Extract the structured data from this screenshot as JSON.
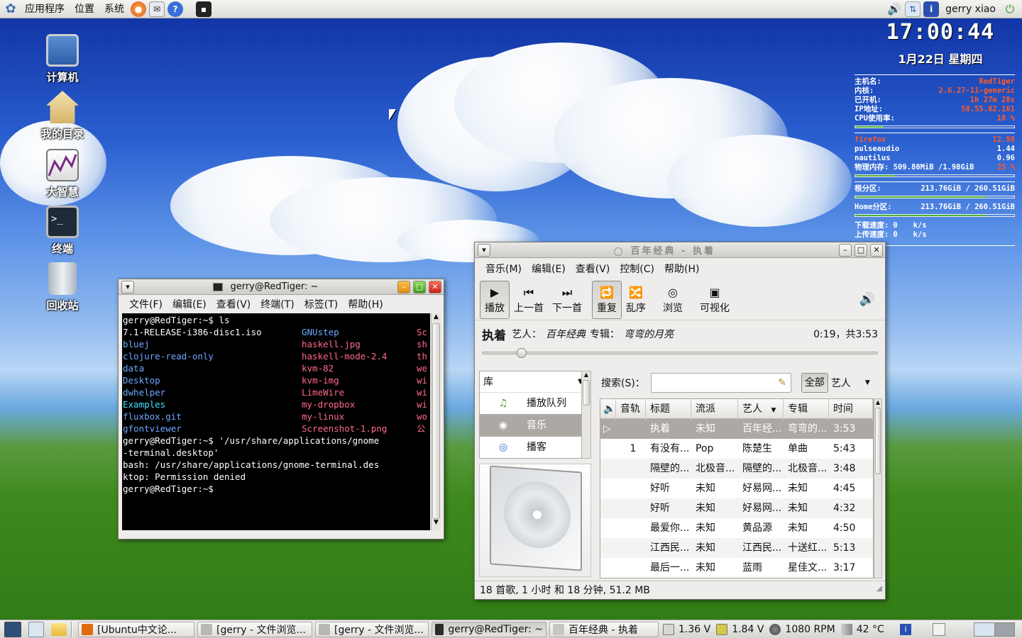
{
  "top_panel": {
    "menus": [
      "应用程序",
      "位置",
      "系统"
    ],
    "user": "gerry  xiao"
  },
  "desktop_icons": [
    {
      "label": "计算机"
    },
    {
      "label": "我的目录"
    },
    {
      "label": "大智慧"
    },
    {
      "label": "终端"
    },
    {
      "label": "回收站"
    }
  ],
  "clock": {
    "time": "17:00:44",
    "date": "1月22日 星期四"
  },
  "conky": {
    "sys": [
      {
        "k": "主机名:",
        "v": "RedTiger"
      },
      {
        "k": "内核:",
        "v": "2.6.27-11-generic"
      },
      {
        "k": "已开机:",
        "v": "1h 27m 28s"
      },
      {
        "k": "IP地址:",
        "v": "58.55.82.161"
      },
      {
        "k": "CPU使用率:",
        "v": "18 %"
      }
    ],
    "cpu_usage_fraction": 0.18,
    "procs": [
      {
        "name": "firefox",
        "val": "12.98"
      },
      {
        "name": "pulseaudio",
        "val": "1.44"
      },
      {
        "name": "nautilus",
        "val": "0.96"
      }
    ],
    "memory": {
      "label": "物理内存:",
      "value": "509.80MiB /1.98GiB",
      "percent": "25 %",
      "fraction": 0.25
    },
    "root_part": {
      "label": "根分区:",
      "value": "213.76GiB / 260.51GiB",
      "fraction": 0.82
    },
    "home_part": {
      "label": "Home分区:",
      "value": "213.76GiB / 260.51GiB",
      "fraction": 0.82
    },
    "down": {
      "label": "下载速度:",
      "value": "0",
      "unit": "k/s"
    },
    "up": {
      "label": "上传速度:",
      "value": "0",
      "unit": "k/s"
    }
  },
  "terminal": {
    "title": "gerry@RedTiger: ~",
    "menus": [
      "文件(F)",
      "编辑(E)",
      "查看(V)",
      "终端(T)",
      "标签(T)",
      "帮助(H)"
    ],
    "prompt1": "gerry@RedTiger:~$ ls",
    "ls_rows": [
      [
        "7.1-RELEASE-i386-disc1.iso",
        "GNUstep",
        "Sc"
      ],
      [
        "bluej",
        "haskell.jpg",
        "sh"
      ],
      [
        "clojure-read-only",
        "haskell-mode-2.4",
        "th"
      ],
      [
        "data",
        "kvm-82",
        "we"
      ],
      [
        "Desktop",
        "kvm-img",
        "wi"
      ],
      [
        "dwhelper",
        "LimeWire",
        "wi"
      ],
      [
        "Examples",
        "my-dropbox",
        "wi"
      ],
      [
        "fluxbox.git",
        "my-linux",
        "wo"
      ],
      [
        "gfontviewer",
        "Screenshot-1.png",
        "公"
      ]
    ],
    "line_cmd1": "gerry@RedTiger:~$ '/usr/share/applications/gnome",
    "line_cmd2": "-terminal.desktop'",
    "line_err1": "bash: /usr/share/applications/gnome-terminal.des",
    "line_err2": "ktop: Permission denied",
    "prompt2": "gerry@RedTiger:~$"
  },
  "player": {
    "title": "百年经典 - 执着",
    "menus": [
      "音乐(M)",
      "编辑(E)",
      "查看(V)",
      "控制(C)",
      "帮助(H)"
    ],
    "toolbar": [
      {
        "label": "播放",
        "icon": "▶"
      },
      {
        "label": "上一首",
        "icon": "⏮"
      },
      {
        "label": "下一首",
        "icon": "⏭"
      },
      {
        "label": "重复",
        "icon": "🔁"
      },
      {
        "label": "乱序",
        "icon": "🔀"
      },
      {
        "label": "浏览",
        "icon": "◎"
      },
      {
        "label": "可视化",
        "icon": "▣"
      }
    ],
    "now_playing": {
      "song": "执着",
      "artist_label": "艺人：",
      "artist": "百年经典",
      "album_label": "专辑：",
      "album": "弯弯的月亮",
      "time": "0:19，共3:53"
    },
    "progress_fraction": 0.09,
    "library": {
      "header": "库",
      "items": [
        "播放队列",
        "音乐",
        "播客"
      ]
    },
    "search_label": "搜索(S)：",
    "search_value": "",
    "filter_all": "全部",
    "filter_field": "艺人",
    "columns": [
      "",
      "音轨",
      "标题",
      "流派",
      "艺人",
      "专辑",
      "时间"
    ],
    "tracks": [
      {
        "play": "▷",
        "track": "",
        "title": "执着",
        "genre": "未知",
        "artist": "百年经...",
        "album": "弯弯的...",
        "time": "3:53"
      },
      {
        "play": "",
        "track": "1",
        "title": "有没有...",
        "genre": "Pop",
        "artist": "陈楚生",
        "album": "单曲",
        "time": "5:43"
      },
      {
        "play": "",
        "track": "",
        "title": "隔壁的...",
        "genre": "北极音...",
        "artist": "隔壁的...",
        "album": "北极音...",
        "time": "3:48"
      },
      {
        "play": "",
        "track": "",
        "title": "好听",
        "genre": "未知",
        "artist": "好易网...",
        "album": "未知",
        "time": "4:45"
      },
      {
        "play": "",
        "track": "",
        "title": "好听",
        "genre": "未知",
        "artist": "好易网...",
        "album": "未知",
        "time": "4:32"
      },
      {
        "play": "",
        "track": "",
        "title": "最爱你...",
        "genre": "未知",
        "artist": "黄品源",
        "album": "未知",
        "time": "4:50"
      },
      {
        "play": "",
        "track": "",
        "title": "江西民...",
        "genre": "未知",
        "artist": "江西民...",
        "album": "十送红...",
        "time": "5:13"
      },
      {
        "play": "",
        "track": "",
        "title": "最后一...",
        "genre": "未知",
        "artist": "蓝雨",
        "album": "星佳文...",
        "time": "3:17"
      }
    ],
    "status": "18 首歌, 1 小时 和 18 分钟, 51.2 MB"
  },
  "taskbar": {
    "tasks": [
      {
        "label": "[Ubuntu中文论...",
        "icon": "firefox-icon",
        "color": "#e06a10"
      },
      {
        "label": "[gerry - 文件浏览...",
        "icon": "folder-icon",
        "color": "#b9b7b2"
      },
      {
        "label": "[gerry - 文件浏览...",
        "icon": "folder-icon",
        "color": "#b9b7b2"
      },
      {
        "label": "gerry@RedTiger: ~",
        "icon": "terminal-icon",
        "color": "#2b2b2b"
      },
      {
        "label": "百年经典 - 执着",
        "icon": "music-icon",
        "color": "#c7c5c0"
      }
    ],
    "sensors": [
      {
        "value": "1.36 V",
        "icon": "voltage-icon"
      },
      {
        "value": "1.84 V",
        "icon": "voltage-icon"
      },
      {
        "value": "1080 RPM",
        "icon": "fan-icon"
      },
      {
        "value": "42 °C",
        "icon": "temperature-icon"
      }
    ]
  }
}
